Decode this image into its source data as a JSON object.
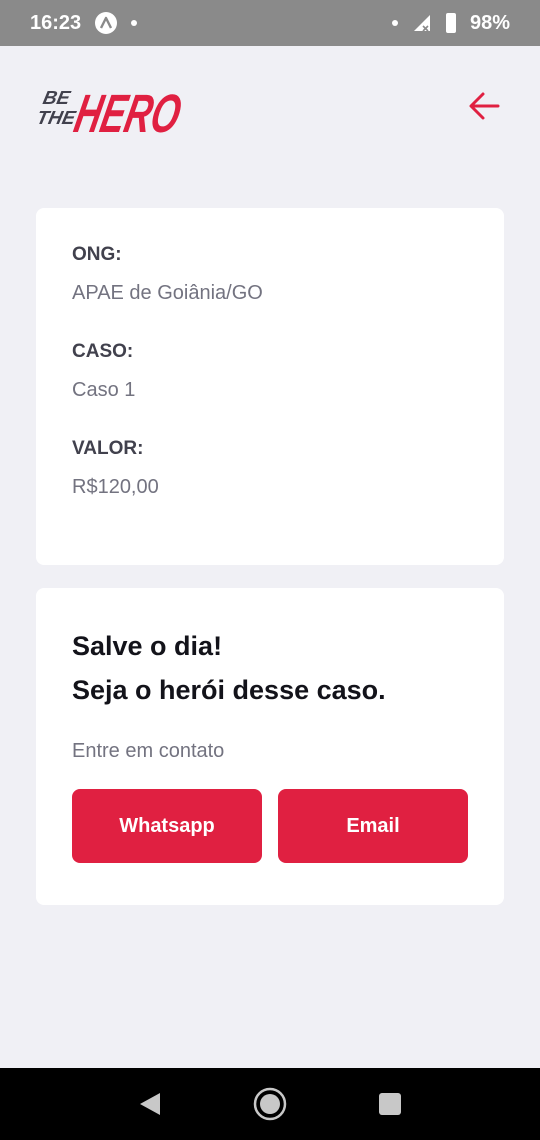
{
  "status_bar": {
    "time": "16:23",
    "battery": "98%",
    "icons": [
      "a-icon",
      "notification-dot",
      "signal-icon",
      "battery-icon"
    ]
  },
  "header": {
    "logo_small_top": "BE",
    "logo_small_bottom": "THE",
    "logo_big": "HERO",
    "back_icon": "arrow-left-icon"
  },
  "incident": {
    "ong_label": "ONG:",
    "ong_value": "APAE de Goiânia/GO",
    "case_label": "CASO:",
    "case_value": "Caso 1",
    "value_label": "VALOR:",
    "value_value": "R$120,00"
  },
  "contact": {
    "title_line1": "Salve o dia!",
    "title_line2": "Seja o herói desse caso.",
    "description": "Entre em contato",
    "whatsapp_label": "Whatsapp",
    "email_label": "Email"
  },
  "colors": {
    "brand": "#e02041",
    "background": "#f0f0f5",
    "card": "#ffffff"
  }
}
